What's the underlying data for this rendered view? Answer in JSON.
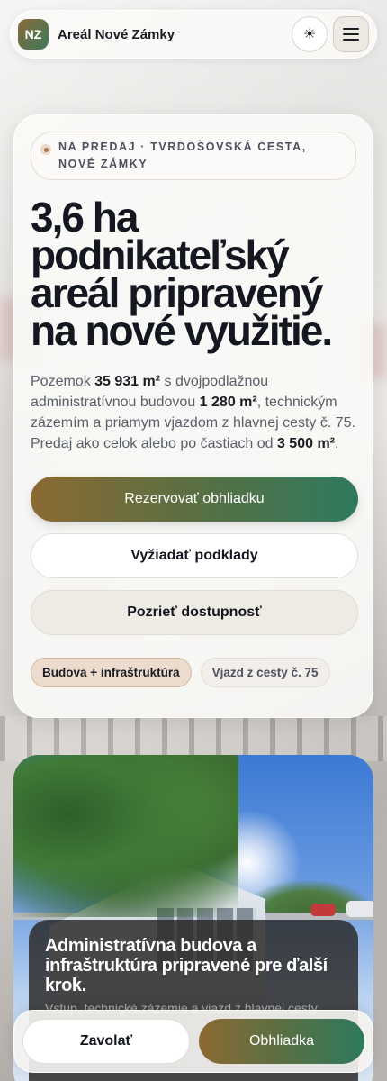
{
  "header": {
    "logo_text": "NZ",
    "brand": "Areál Nové Zámky",
    "theme_icon": "sun-icon",
    "menu_icon": "hamburger-icon"
  },
  "hero": {
    "eyebrow": "NA PREDAJ · TVRDOŠOVSKÁ CESTA, NOVÉ ZÁMKY",
    "title_lines": [
      "3,6 ha",
      "podnikateľský",
      "areál pripravený",
      "na nové využitie."
    ],
    "lead": {
      "t1": "Pozemok ",
      "b1": "35 931 m²",
      "t2": " s dvojpodlažnou administratívnou budovou ",
      "b2": "1 280 m²",
      "t3": ", technickým zázemím a priamym vjazdom z hlavnej cesty č. 75. Predaj ako celok alebo po častiach od ",
      "b3": "3 500 m²",
      "t4": "."
    },
    "buttons": {
      "primary": "Rezervovať obhliadku",
      "documents": "Vyžiadať podklady",
      "availability": "Pozrieť dostupnosť"
    },
    "chips": [
      "Budova + infraštruktúra",
      "Vjazd z cesty č. 75"
    ]
  },
  "photo_card": {
    "title": "Administratívna budova a infraštruktúra pripravené pre ďalší krok.",
    "subtitle": "Vstup, technické zázemie a vjazd z hlavnej cesty"
  },
  "bottom_bar": {
    "call": "Zavolať",
    "visit": "Obhliadka"
  },
  "colors": {
    "accent_start": "#8c6a33",
    "accent_end": "#2e7a5e",
    "text_dark": "#14171f"
  }
}
